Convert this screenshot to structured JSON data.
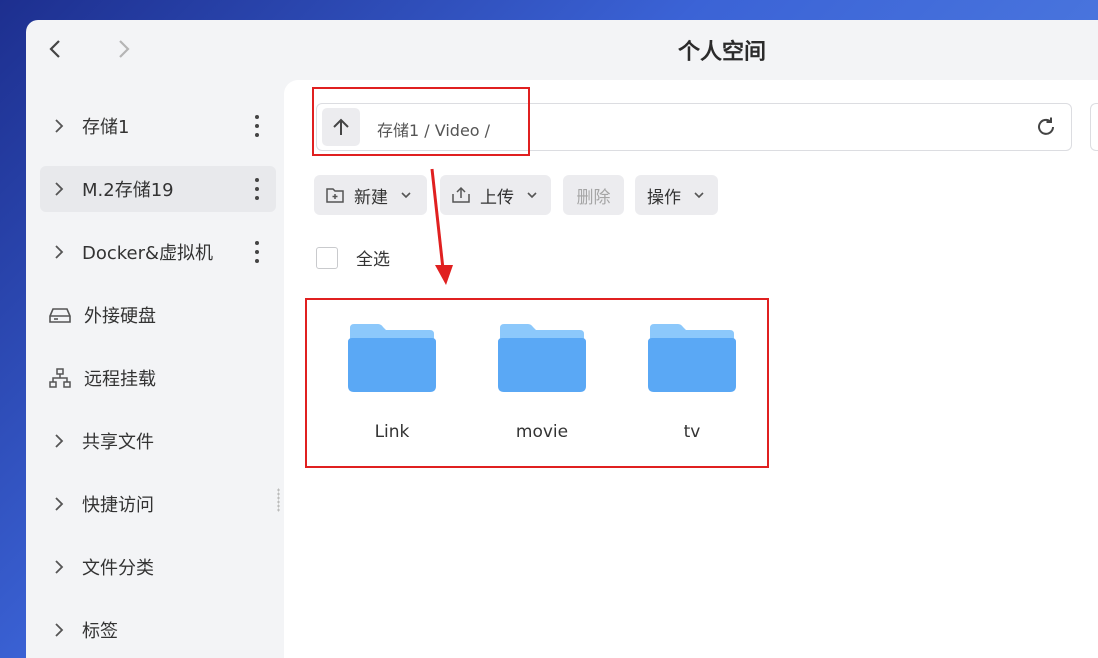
{
  "window": {
    "title": "个人空间"
  },
  "sidebar": {
    "items": [
      {
        "label": "存储1",
        "type": "expand",
        "kebab": true
      },
      {
        "label": "M.2存储19",
        "type": "expand",
        "kebab": true,
        "active": true
      },
      {
        "label": "Docker&虚拟机",
        "type": "expand",
        "kebab": true
      },
      {
        "label": "外接硬盘",
        "type": "icon",
        "icon": "external-drive-icon"
      },
      {
        "label": "远程挂载",
        "type": "icon",
        "icon": "network-mount-icon"
      },
      {
        "label": "共享文件",
        "type": "expand"
      },
      {
        "label": "快捷访问",
        "type": "expand"
      },
      {
        "label": "文件分类",
        "type": "expand"
      },
      {
        "label": "标签",
        "type": "expand"
      }
    ]
  },
  "pathbar": {
    "path": "存储1 / Video /"
  },
  "toolbar": {
    "new_label": "新建",
    "upload_label": "上传",
    "delete_label": "删除",
    "operations_label": "操作"
  },
  "select_all_label": "全选",
  "folders": [
    {
      "name": "Link"
    },
    {
      "name": "movie"
    },
    {
      "name": "tv"
    }
  ],
  "colors": {
    "accent_highlight": "#e02020",
    "folder_front": "#5aa8f5",
    "folder_back": "#8cc8fb"
  }
}
